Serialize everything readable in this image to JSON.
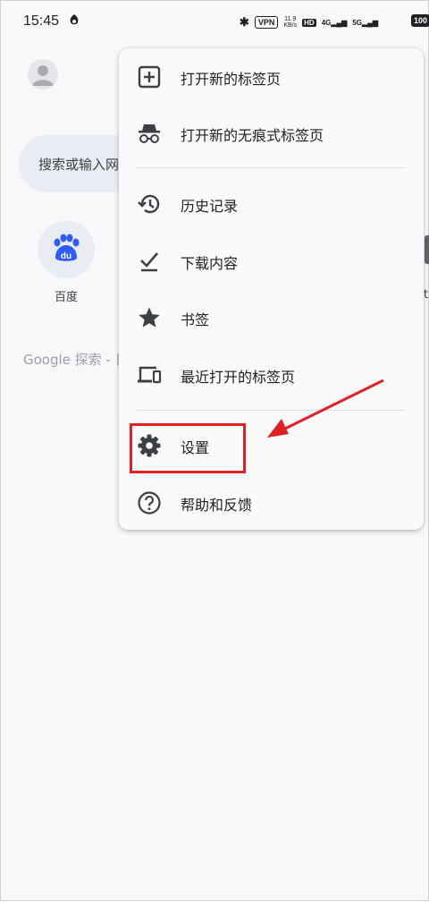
{
  "status_bar": {
    "time": "15:45",
    "vpn": "VPN",
    "speed_value": "11.9",
    "speed_unit": "KB/s",
    "hd": "HD",
    "net1": "4G",
    "net2": "5G",
    "battery": "100"
  },
  "page": {
    "search_placeholder": "搜索或输入网",
    "tile_label": "百度",
    "google_text": "Google 探索 - 日",
    "edge_char": "t"
  },
  "menu": {
    "items": [
      {
        "label": "打开新的标签页",
        "icon": "new-tab-icon"
      },
      {
        "label": "打开新的无痕式标签页",
        "icon": "incognito-icon"
      },
      {
        "label": "历史记录",
        "icon": "history-icon"
      },
      {
        "label": "下载内容",
        "icon": "download-icon"
      },
      {
        "label": "书签",
        "icon": "star-icon"
      },
      {
        "label": "最近打开的标签页",
        "icon": "devices-icon"
      },
      {
        "label": "设置",
        "icon": "gear-icon"
      },
      {
        "label": "帮助和反馈",
        "icon": "help-icon"
      }
    ]
  },
  "colors": {
    "annotation_red": "#e32020",
    "icon_dark": "#3c4043"
  }
}
